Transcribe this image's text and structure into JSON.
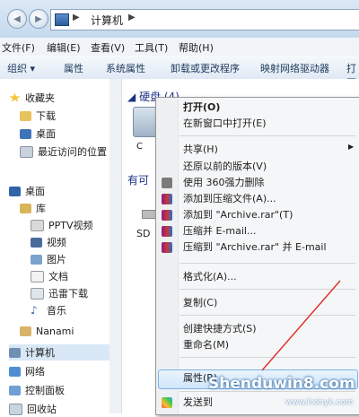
{
  "address": {
    "path": "计算机",
    "back_glyph": "◀",
    "forward_glyph": "▶",
    "sep": "▶"
  },
  "menubar": [
    "文件(F)",
    "编辑(E)",
    "查看(V)",
    "工具(T)",
    "帮助(H)"
  ],
  "toolbar": [
    "组织 ▾",
    "属性",
    "系统属性",
    "卸载或更改程序",
    "映射网络驱动器",
    "打开控制面板"
  ],
  "nav": {
    "favorites": "收藏夹",
    "favorites_items": [
      "下载",
      "桌面",
      "最近访问的位置"
    ],
    "desktop": "桌面",
    "library": "库",
    "library_items": [
      "PPTV视频",
      "视频",
      "图片",
      "文档",
      "迅雷下载",
      "音乐"
    ],
    "user": "Nanami",
    "computer": "计算机",
    "network": "网络",
    "control_panel": "控制面板",
    "recycle": "回收站"
  },
  "content": {
    "hard_disk_group": "硬盘 (4)",
    "removable_group_partial": "有可",
    "drive_letter_partial": "C",
    "sd_label_partial": "SD"
  },
  "context_menu": {
    "open": "打开(O)",
    "open_new_window": "在新窗口中打开(E)",
    "share": "共享(H)",
    "restore": "还原以前的版本(V)",
    "delete_360": "使用 360强力删除",
    "add_archive": "添加到压缩文件(A)...",
    "add_archive_rar": "添加到 \"Archive.rar\"(T)",
    "compress_email": "压缩并 E-mail...",
    "compress_rar_email": "压缩到 \"Archive.rar\" 并 E-mail",
    "format": "格式化(A)...",
    "copy": "复制(C)",
    "create_shortcut": "创建快捷方式(S)",
    "rename": "重命名(M)",
    "properties": "属性(R)",
    "send_to_partial": "发送到"
  },
  "watermark": {
    "main": "Shenduwin8.com",
    "sub": "www.kxinyk.com"
  },
  "colors": {
    "accent": "#7db2e6",
    "group_title": "#1e3287"
  }
}
